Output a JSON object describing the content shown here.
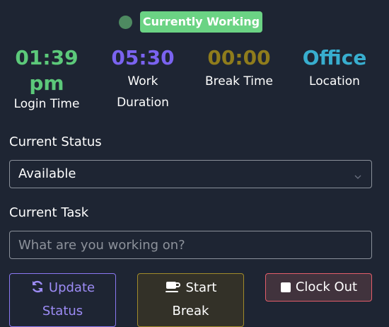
{
  "status": {
    "badge_label": "Currently Working",
    "dot_color": "#4e8a61",
    "badge_color": "#6bd384"
  },
  "stats": {
    "login": {
      "value_line1": "01:39",
      "value_line2": "pm",
      "label": "Login Time",
      "color": "#5cc97a"
    },
    "work": {
      "value": "05:30",
      "label_line1": "Work",
      "label_line2": "Duration",
      "color": "#7a63f0"
    },
    "break": {
      "value": "00:00",
      "label": "Break Time",
      "color": "#8f7c1c"
    },
    "location": {
      "value": "Office",
      "label": "Location",
      "color": "#38aecf"
    }
  },
  "form": {
    "status_label": "Current Status",
    "status_selected": "Available",
    "task_label": "Current Task",
    "task_placeholder": "What are you working on?",
    "task_value": ""
  },
  "buttons": {
    "update_line1": "Update",
    "update_line2": "Status",
    "update_icon": "refresh-icon",
    "break_line1": "Start",
    "break_line2": "Break",
    "break_icon": "coffee-icon",
    "clock_out": "Clock Out",
    "clock_icon": "stop-square-icon"
  }
}
